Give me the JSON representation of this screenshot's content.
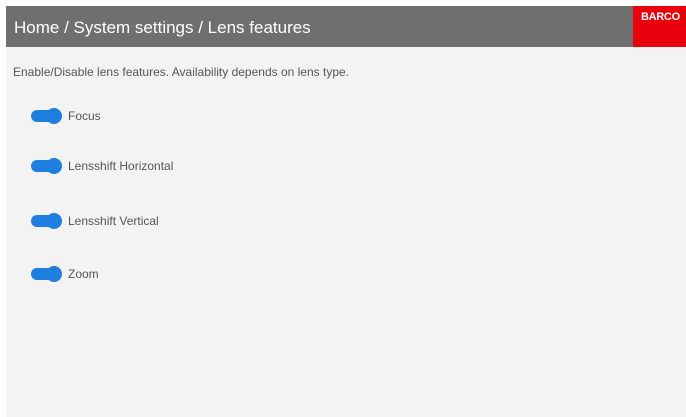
{
  "header": {
    "breadcrumb": "Home / System settings / Lens features",
    "logo_text": "BARCO",
    "colors": {
      "header_background": "#6f6f6f",
      "logo_background": "#e8000d"
    }
  },
  "main": {
    "description": "Enable/Disable lens features. Availability depends on lens type.",
    "toggle_color": "#1e7fe0",
    "features": [
      {
        "label": "Focus",
        "enabled": true
      },
      {
        "label": "Lensshift Horizontal",
        "enabled": true
      },
      {
        "label": "Lensshift Vertical",
        "enabled": true
      },
      {
        "label": "Zoom",
        "enabled": true
      }
    ]
  }
}
